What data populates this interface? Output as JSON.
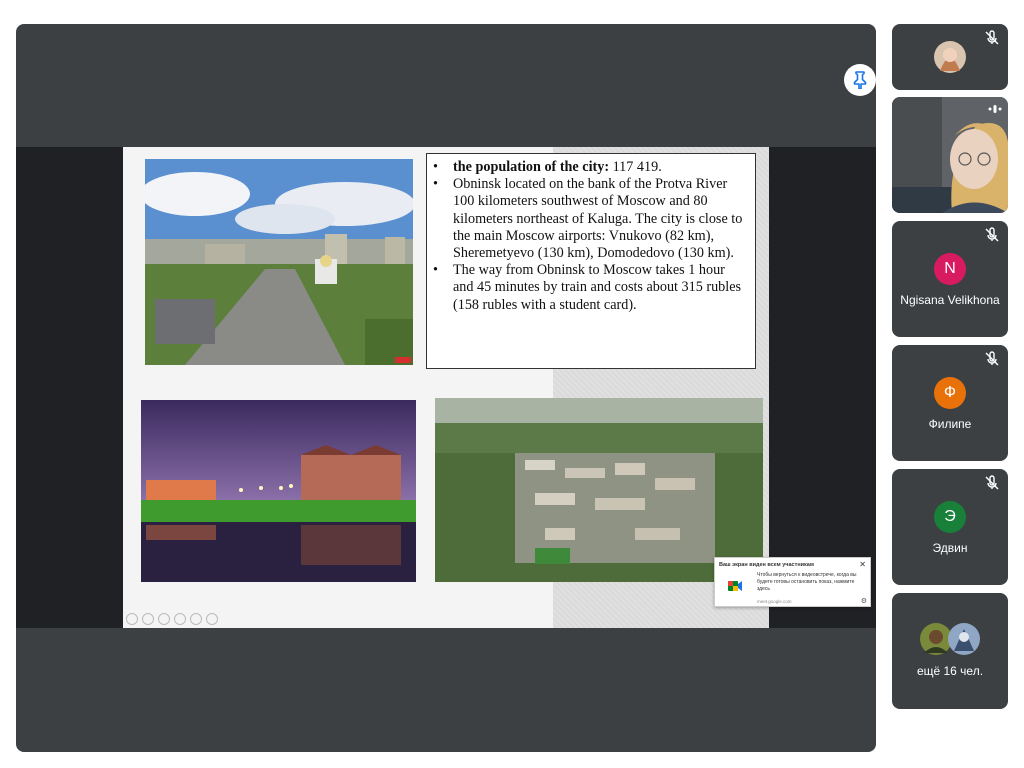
{
  "slide": {
    "bullets": [
      {
        "bold": "the population of the city:",
        "text": " 117 419."
      },
      {
        "bold": "",
        "text": "Obninsk located on the bank of the Protva River 100 kilometers southwest of Moscow and 80 kilometers northeast of Kaluga. The city is close to the main Moscow airports: Vnukovo (82 km), Sheremetyevo (130 km), Domodedovo (130 km)."
      },
      {
        "bold": "",
        "text": "The way from Obninsk to Moscow  takes 1 hour and 45 minutes by train and costs about 315 rubles (158 rubles with a student card)."
      }
    ]
  },
  "notice": {
    "title": "Ваш экран виден всем участникам",
    "body": "Чтобы вернуться к видеовстрече, когда вы будете готовы остановить показ, нажмите здесь",
    "url": "meet.google.com"
  },
  "participants": [
    {
      "name": "",
      "initial": "",
      "mic": "muted"
    },
    {
      "name": "",
      "initial": "",
      "mic": "speaking"
    },
    {
      "name": "Ngisana Velikhona",
      "initial": "N",
      "color": "#d81b60",
      "mic": "muted"
    },
    {
      "name": "Филипе",
      "initial": "Ф",
      "color": "#e8710a",
      "mic": "muted"
    },
    {
      "name": "Эдвин",
      "initial": "Э",
      "color": "#188038",
      "mic": "muted"
    }
  ],
  "more": {
    "label": "ещё 16 чел."
  },
  "icons": {
    "pin": "pin-icon",
    "mic_off": "mic-off-icon",
    "close": "close-icon",
    "settings": "gear-icon"
  }
}
